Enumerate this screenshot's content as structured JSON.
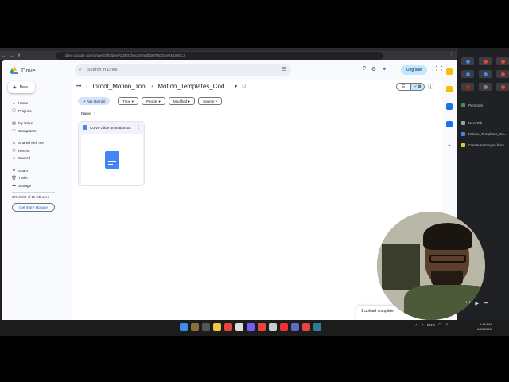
{
  "browser": {
    "url": "drive.google.com/drive/u/1/folders/1d4f02fy5cgSmrd0bM7BdO2vGMb0ECJ"
  },
  "drive": {
    "logo_text": "Drive",
    "search_placeholder": "Search in Drive",
    "upgrade_label": "Upgrade",
    "avatar_letter": "A",
    "new_label": "New",
    "sidebar": {
      "items": [
        {
          "label": "Home",
          "icon": "home-icon"
        },
        {
          "label": "Projects",
          "icon": "projects-icon"
        },
        {
          "label": "My Drive",
          "icon": "my-drive-icon"
        },
        {
          "label": "Computers",
          "icon": "computer-icon"
        },
        {
          "label": "Shared with me",
          "icon": "shared-icon"
        },
        {
          "label": "Recent",
          "icon": "clock-icon"
        },
        {
          "label": "Starred",
          "icon": "star-icon"
        },
        {
          "label": "Spam",
          "icon": "spam-icon"
        },
        {
          "label": "Trash",
          "icon": "trash-icon"
        },
        {
          "label": "Storage",
          "icon": "cloud-icon"
        }
      ],
      "storage_text": "378.2 MB of 15 GB used",
      "get_storage_label": "Get more storage"
    },
    "breadcrumb": {
      "parent": "Inroot_Motion_Tool",
      "current": "Motion_Templates_Cod..."
    },
    "filters": {
      "gemini": "Ask Gemini",
      "type": "Type",
      "people": "People",
      "modified": "Modified",
      "source": "Source"
    },
    "name_column": "Name",
    "file": {
      "name": "Curve Glide animation.txt"
    },
    "toast": {
      "title": "1 upload complete",
      "file": "Curve Glide animation.txt"
    }
  },
  "side_panel": {
    "items": [
      {
        "label": "Personal",
        "color": "#3c8f5f"
      },
      {
        "label": "New Tab",
        "color": "#9aa0a6"
      },
      {
        "label": "Motion_Templates_Co...",
        "color": "#4285f4"
      },
      {
        "label": "Create AI Images from...",
        "color": "#c7d63a"
      }
    ]
  },
  "taskbar": {
    "time": "8:49 PM",
    "date": "6/20/2026",
    "lang": "ENG"
  }
}
